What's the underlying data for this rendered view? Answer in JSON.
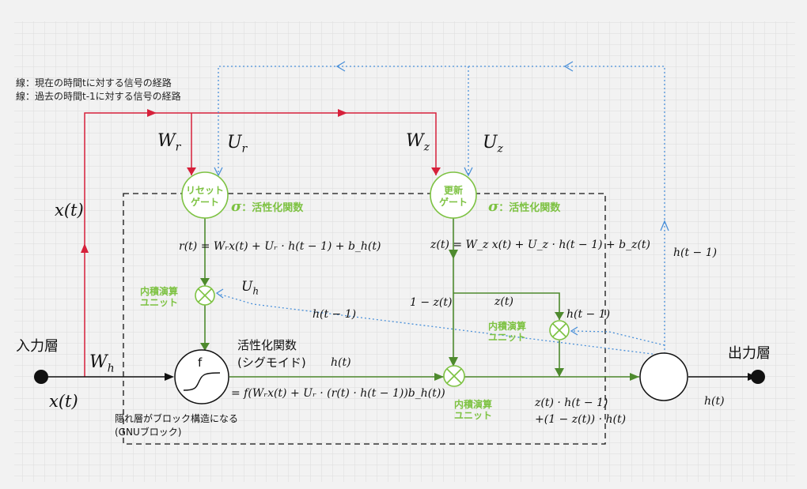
{
  "legend": {
    "red": "線：現在の時間tに対する信号の経路",
    "blue": "線：過去の時間t-1に対する信号の経路"
  },
  "labels": {
    "w_r_sub": "r",
    "u_r_sub": "r",
    "w_z_sub": "z",
    "u_z_sub": "z",
    "w_h_sub": "h",
    "u_h_sub": "h",
    "x_t": "x(t)",
    "input_layer": "入力層",
    "output_layer": "出力層",
    "sigma": "σ",
    "sigma_desc": "：活性化関数",
    "product_line1": "内積演算",
    "product_line2": "ユニット",
    "h_t1": "h(t − 1)",
    "h_t": "h(t)",
    "one_minus_z": "1 − z(t)",
    "z_t": "z(t)",
    "f": "f",
    "activation_title": "活性化関数",
    "activation_subtitle": "(シグモイド)",
    "block_note_line1": "隠れ層がブロック構造になる",
    "block_note_line2": "(GNUブロック)"
  },
  "gates": {
    "reset_line1": "リセット",
    "reset_line2": "ゲート",
    "update_line1": "更新",
    "update_line2": "ゲート"
  },
  "equations": {
    "r": "r(t)   = Wᵣx(t) + Uᵣ · h(t − 1) + b_h(t)",
    "z": "z(t) = W_z x(t) + U_z · h(t − 1) + b_z(t)",
    "h_candidate": "= f(Wᵣx(t) + Uᵣ · (r(t) · h(t − 1))b_h(t))",
    "h_out_line1": "z(t) · h(t − 1)",
    "h_out_line2": "+(1 − z(t)) · h(t)"
  },
  "colors": {
    "current_path": "#d6203a",
    "past_path": "#4a90d9",
    "gate": "#7dc242",
    "flow": "#4e8a2e"
  }
}
